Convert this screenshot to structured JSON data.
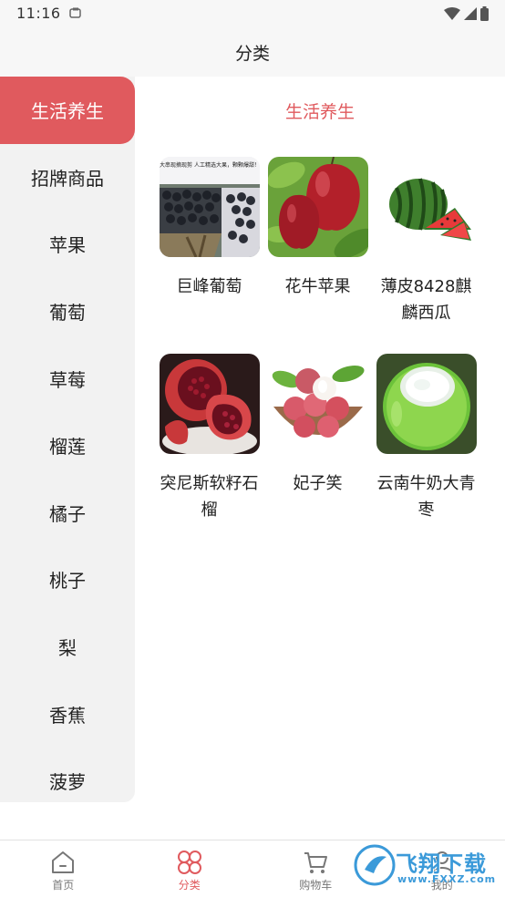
{
  "status_bar": {
    "time": "11:16"
  },
  "header": {
    "title": "分类"
  },
  "sidebar": {
    "items": [
      {
        "label": "生活养生",
        "active": true
      },
      {
        "label": "招牌商品"
      },
      {
        "label": "苹果"
      },
      {
        "label": "葡萄"
      },
      {
        "label": "草莓"
      },
      {
        "label": "榴莲"
      },
      {
        "label": "橘子"
      },
      {
        "label": "桃子"
      },
      {
        "label": "梨"
      },
      {
        "label": "香蕉"
      },
      {
        "label": "菠萝"
      }
    ]
  },
  "main": {
    "section_title": "生活养生",
    "products": [
      {
        "name": "巨峰葡萄",
        "image": "grape-box-photo",
        "image_text": "大串现摘现剪 人工精选大果，颗颗爆甜！"
      },
      {
        "name": "花牛苹果",
        "image": "red-apple-photo"
      },
      {
        "name": "薄皮8428麒麟西瓜",
        "image": "watermelon-photo"
      },
      {
        "name": "突尼斯软籽石榴",
        "image": "pomegranate-photo"
      },
      {
        "name": "妃子笑",
        "image": "lychee-photo"
      },
      {
        "name": "云南牛奶大青枣",
        "image": "green-jujube-photo"
      }
    ]
  },
  "tab_bar": {
    "tabs": [
      {
        "label": "首页",
        "icon": "home-icon"
      },
      {
        "label": "分类",
        "icon": "category-icon",
        "active": true
      },
      {
        "label": "购物车",
        "icon": "cart-icon"
      },
      {
        "label": "我的",
        "icon": "profile-icon"
      }
    ]
  },
  "watermark": {
    "brand": "飞翔下载",
    "url": "www.FXXZ.com"
  },
  "colors": {
    "accent": "#e05a5e",
    "sidebar_bg": "#f2f2f2",
    "header_bg": "#f7f7f7"
  }
}
